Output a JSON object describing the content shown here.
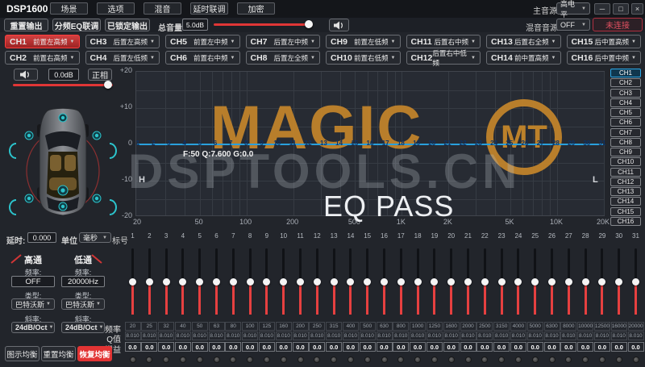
{
  "titlebar": {
    "app_title": "DSP1600",
    "menus": [
      "场景",
      "选项",
      "混音",
      "延时联调",
      "加密"
    ],
    "main_source_label": "主音源",
    "main_source_value": "高电平",
    "window_buttons": {
      "minimize": "─",
      "maximize": "□",
      "close": "×"
    }
  },
  "toolbar": {
    "reset_output": "重置输出",
    "crossover_eq_link": "分频EQ联调",
    "locked_output": "已锁定输出",
    "master_volume_label": "总音量",
    "master_volume_value": "5.0dB",
    "mix_source_label": "混音音源",
    "mix_source_value": "OFF",
    "connection_status": "未连接"
  },
  "channels": [
    {
      "id": "CH1",
      "name": "前置左高频",
      "selected": true
    },
    {
      "id": "CH2",
      "name": "前置右高频"
    },
    {
      "id": "CH3",
      "name": "后置左高频"
    },
    {
      "id": "CH4",
      "name": "后置左低频"
    },
    {
      "id": "CH5",
      "name": "前置左中频"
    },
    {
      "id": "CH6",
      "name": "前置右中频"
    },
    {
      "id": "CH7",
      "name": "后置左中频"
    },
    {
      "id": "CH8",
      "name": "后置左全频"
    },
    {
      "id": "CH9",
      "name": "前置左低频"
    },
    {
      "id": "CH10",
      "name": "前置右低频"
    },
    {
      "id": "CH11",
      "name": "后置右中频"
    },
    {
      "id": "CH12",
      "name": "后置右中低频"
    },
    {
      "id": "CH13",
      "name": "后置右全频"
    },
    {
      "id": "CH14",
      "name": "前中置高频"
    },
    {
      "id": "CH15",
      "name": "后中置高频"
    },
    {
      "id": "CH16",
      "name": "后中置中频"
    }
  ],
  "channel_strip": {
    "gain_value": "0.0dB",
    "phase_button": "正相"
  },
  "eq_graph": {
    "selected_band_info": "F:50 Q:7.600 G:0.0",
    "y_tick_labels": [
      "+20",
      "+10",
      "0",
      "-10",
      "-20"
    ],
    "x_ticks": [
      {
        "label": "20",
        "freq": 20
      },
      {
        "label": "50",
        "freq": 50
      },
      {
        "label": "100",
        "freq": 100
      },
      {
        "label": "200",
        "freq": 200
      },
      {
        "label": "500",
        "freq": 500
      },
      {
        "label": "1K",
        "freq": 1000
      },
      {
        "label": "2K",
        "freq": 2000
      },
      {
        "label": "5K",
        "freq": 5000
      },
      {
        "label": "10K",
        "freq": 10000
      },
      {
        "label": "20K",
        "freq": 20000
      }
    ],
    "hp_marker": "H",
    "lp_marker": "L",
    "watermark_title": "MAGIC",
    "watermark_badge": "MT",
    "watermark_domain": "DSPTOOLS.CN",
    "mode_overlay": "EQ PASS",
    "band_count": 31
  },
  "delay_bar": {
    "delay_label": "延时:",
    "delay_value": "0.000",
    "unit_label": "单位",
    "unit_value": "毫秒",
    "band_index_label": "标号"
  },
  "crossover": {
    "highpass": {
      "title": "高通",
      "freq_label": "频率:",
      "freq_value": "OFF",
      "type_label": "类型:",
      "type_value": "巴特沃斯",
      "slope_label": "斜率:",
      "slope_value": "24dB/Oct"
    },
    "lowpass": {
      "title": "低通",
      "freq_label": "频率:",
      "freq_value": "20000Hz",
      "type_label": "类型:",
      "type_value": "巴特沃斯",
      "slope_label": "斜率:",
      "slope_value": "24dB/Oct"
    }
  },
  "eq_bands": {
    "freq_row_label": "频率",
    "q_row_label": "Q值",
    "gain_row_label": "增益",
    "frequencies": [
      "20",
      "25",
      "32",
      "40",
      "50",
      "63",
      "80",
      "100",
      "125",
      "160",
      "200",
      "250",
      "315",
      "400",
      "500",
      "630",
      "800",
      "1000",
      "1250",
      "1600",
      "2000",
      "2500",
      "3150",
      "4000",
      "5000",
      "6300",
      "8000",
      "10000",
      "12500",
      "16000",
      "20000"
    ],
    "q_value": "8.010",
    "gain_value": "0.0"
  },
  "eq_buttons": {
    "graphic": "图示均衡",
    "reset": "重置均衡",
    "restore": "恢复均衡"
  },
  "colors": {
    "accent_red": "#e03636",
    "eq_line_blue": "#2aa0dc",
    "watermark_gold": "#c48628",
    "selected_channel_red": "#c23030",
    "selected_tab_blue": "#2da8e8",
    "speaker_teal": "#2cc4cc"
  }
}
